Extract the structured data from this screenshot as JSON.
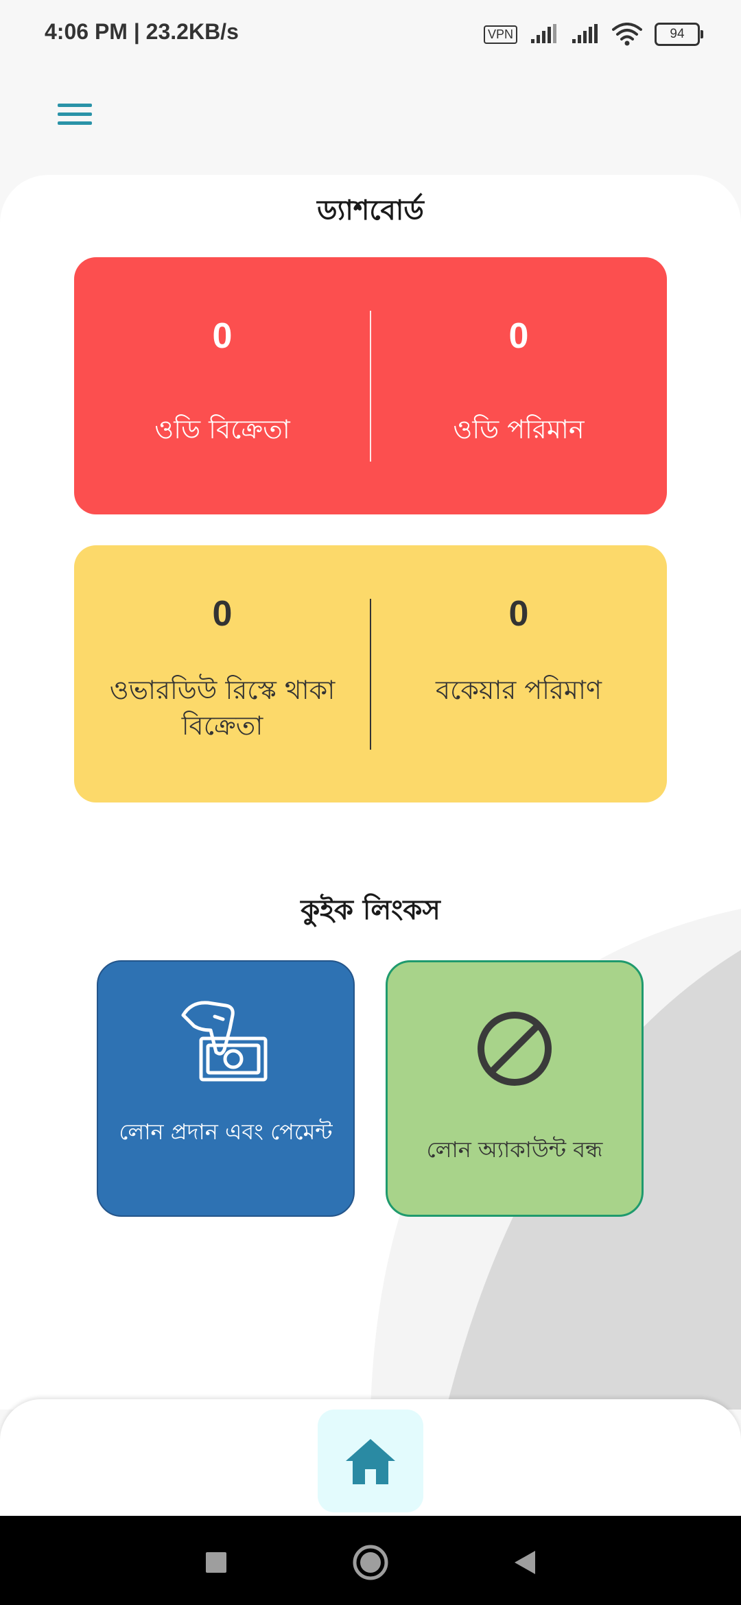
{
  "status_bar": {
    "time": "4:06 PM | 23.2KB/s",
    "vpn": "VPN",
    "battery": "94"
  },
  "dashboard": {
    "title": "ড্যাশবোর্ড",
    "od_seller_value": "0",
    "od_seller_label": "ওডি বিক্রেতা",
    "od_amount_value": "0",
    "od_amount_label": "ওডি পরিমান",
    "overdue_risk_value": "0",
    "overdue_risk_label": "ওভারডিউ রিস্কে থাকা বিক্রেতা",
    "due_amount_value": "0",
    "due_amount_label": "বকেয়ার পরিমাণ"
  },
  "quick_links": {
    "title": "কুইক লিংকস",
    "loan_payment_label": "লোন প্রদান এবং পেমেন্ট",
    "close_account_label": "লোন অ্যাকাউন্ট বন্ধ"
  },
  "colors": {
    "accent_teal": "#2a93a8",
    "red_card": "#fc4f4f",
    "yellow_card": "#fcd96a",
    "blue_tile": "#2e72b3",
    "green_tile": "#a8d38a"
  },
  "icons": {
    "menu": "hamburger-menu-icon",
    "loan_payment": "hand-cash-icon",
    "close_account": "prohibited-icon",
    "home": "home-icon"
  }
}
